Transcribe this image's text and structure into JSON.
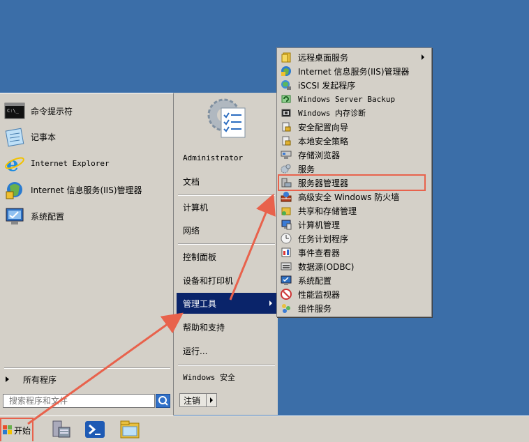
{
  "start_menu": {
    "pinned": [
      {
        "label": "命令提示符",
        "icon": "cmd-icon"
      },
      {
        "label": "记事本",
        "icon": "notepad-icon"
      },
      {
        "label": "Internet Explorer",
        "icon": "ie-icon"
      },
      {
        "label": "Internet 信息服务(IIS)管理器",
        "icon": "iis-icon"
      },
      {
        "label": "系统配置",
        "icon": "msconfig-icon"
      }
    ],
    "all_programs": "所有程序",
    "search_placeholder": "搜索程序和文件",
    "right": {
      "user": "Administrator",
      "documents": "文档",
      "computer": "计算机",
      "network": "网络",
      "control_panel": "控制面板",
      "devices_printers": "设备和打印机",
      "admin_tools": "管理工具",
      "help": "帮助和支持",
      "run": "运行...",
      "windows_security": "Windows 安全"
    },
    "logoff": "注销"
  },
  "submenu": {
    "items": [
      {
        "label": "远程桌面服务",
        "icon": "folder-icon",
        "has_arrow": true
      },
      {
        "label": "Internet 信息服务(IIS)管理器",
        "icon": "iis-icon"
      },
      {
        "label": "iSCSI 发起程序",
        "icon": "iscsi-icon"
      },
      {
        "label": "Windows Server Backup",
        "icon": "backup-icon"
      },
      {
        "label": "Windows 内存诊断",
        "icon": "memory-icon"
      },
      {
        "label": "安全配置向导",
        "icon": "security-wizard-icon"
      },
      {
        "label": "本地安全策略",
        "icon": "security-policy-icon"
      },
      {
        "label": "存储浏览器",
        "icon": "storage-icon"
      },
      {
        "label": "服务",
        "icon": "services-icon"
      },
      {
        "label": "服务器管理器",
        "icon": "server-manager-icon"
      },
      {
        "label": "高级安全 Windows 防火墙",
        "icon": "firewall-icon"
      },
      {
        "label": "共享和存储管理",
        "icon": "share-icon"
      },
      {
        "label": "计算机管理",
        "icon": "computer-mgmt-icon"
      },
      {
        "label": "任务计划程序",
        "icon": "clock-icon"
      },
      {
        "label": "事件查看器",
        "icon": "event-viewer-icon"
      },
      {
        "label": "数据源(ODBC)",
        "icon": "odbc-icon"
      },
      {
        "label": "系统配置",
        "icon": "msconfig-icon"
      },
      {
        "label": "性能监视器",
        "icon": "perfmon-icon"
      },
      {
        "label": "组件服务",
        "icon": "component-icon"
      }
    ]
  },
  "taskbar": {
    "start_label": "开始",
    "icons": [
      "server-manager-icon",
      "powershell-icon",
      "explorer-icon"
    ]
  },
  "colors": {
    "desktop": "#3b6ea8",
    "highlight": "#0a246a",
    "annotation": "#e8624c"
  }
}
